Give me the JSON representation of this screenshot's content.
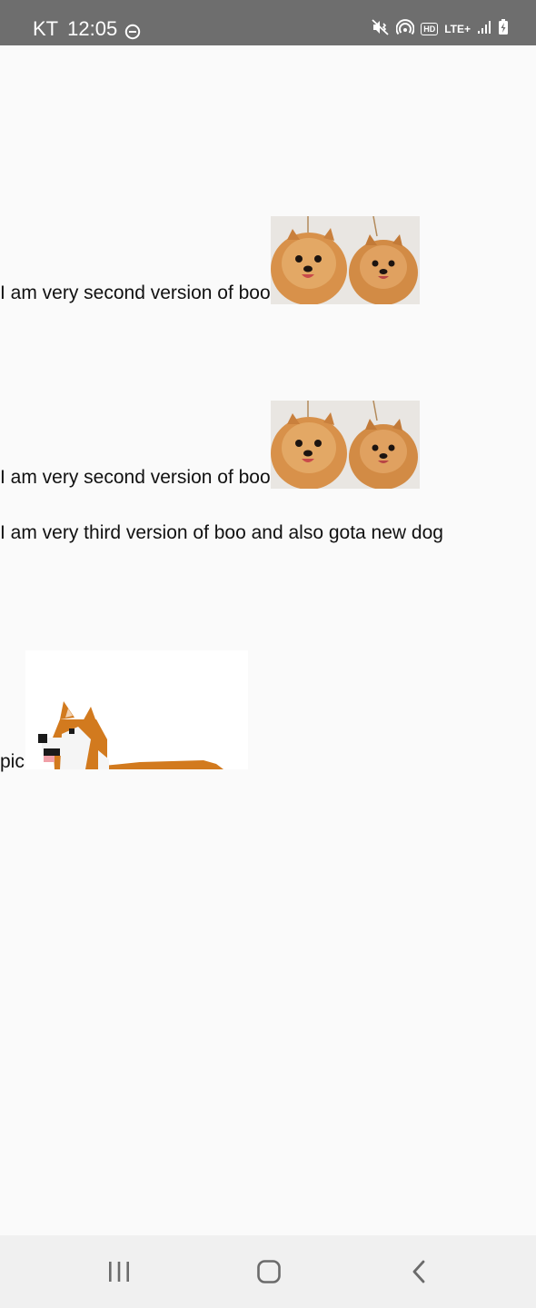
{
  "status_bar": {
    "carrier": "KT",
    "time": "12:05",
    "network_label": "LTE+",
    "hd_label": "HD",
    "icons": [
      "do-not-disturb-icon",
      "mute-vibrate-icon",
      "hotspot-icon",
      "hd-voice-icon",
      "lte-plus-icon",
      "signal-icon",
      "battery-charging-icon"
    ]
  },
  "content": {
    "rows": [
      {
        "text": "I am very second version of boo",
        "image": "two-pomeranians-photo"
      },
      {
        "text": "I am very second version of boo",
        "image": "two-pomeranians-photo"
      },
      {
        "text": "I am very third version of boo and also gota new dog"
      },
      {
        "text": "pic",
        "image": "pixel-corgi-image"
      }
    ]
  },
  "nav_bar": {
    "buttons": [
      "recents-button",
      "home-button",
      "back-button"
    ]
  },
  "colors": {
    "status_bar_bg": "#6e6e6e",
    "page_bg": "#fafafa",
    "nav_bar_bg": "#f0f0f0",
    "nav_icon": "#6b6b6b",
    "pom_fur": "#d9954a",
    "corgi_orange": "#d27a1e"
  }
}
